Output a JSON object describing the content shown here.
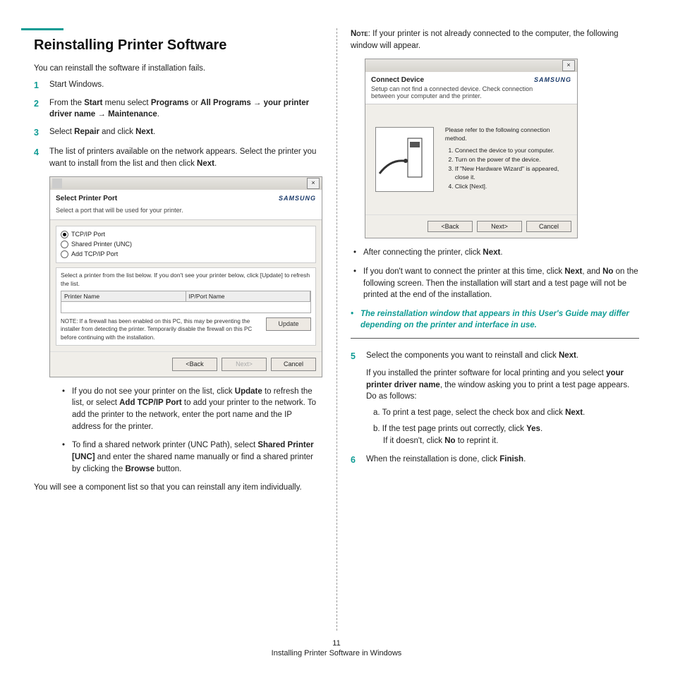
{
  "heading": "Reinstalling Printer Software",
  "intro": "You can reinstall the software if installation fails.",
  "step1": "Start Windows.",
  "step2_a": "From the ",
  "step2_start": "Start",
  "step2_b": " menu select ",
  "step2_programs": "Programs",
  "step2_or": " or ",
  "step2_allprograms": "All Programs",
  "step2_arrow1": " → ",
  "step2_driver": "your printer driver name",
  "step2_arrow2": " → ",
  "step2_maint": "Maintenance",
  "step3_a": "Select ",
  "step3_repair": "Repair",
  "step3_b": " and click ",
  "step3_next": "Next",
  "step4_a": "The list of printers available on the network appears. Select the printer you want to install from the list and then click ",
  "step4_next": "Next",
  "ss1": {
    "title": "Select Printer Port",
    "subtitle": "Select a port that will be used for your printer.",
    "brand": "SAMSUNG",
    "r1": "TCP/IP Port",
    "r2": "Shared Printer (UNC)",
    "r3": "Add TCP/IP Port",
    "listlbl": "Select a printer from the list below. If you don't see your printer below, click [Update] to refresh the list.",
    "th1": "Printer Name",
    "th2": "IP/Port Name",
    "note": "NOTE: If a firewall has been enabled on this PC, this may be preventing the installer from detecting the printer. Temporarily disable the firewall on this PC before continuing with the installation.",
    "update": "Update",
    "back": "<Back",
    "next": "Next>",
    "cancel": "Cancel"
  },
  "bullet1_a": "If you do not see your printer on the list, click ",
  "bullet1_update": "Update",
  "bullet1_b": " to refresh the list, or select ",
  "bullet1_add": "Add TCP/IP Port",
  "bullet1_c": " to add your printer to the network. To add the printer to the network, enter the port name and the IP address for the printer.",
  "bullet2_a": "To find a shared network printer (UNC Path), select ",
  "bullet2_shared": "Shared Printer [UNC]",
  "bullet2_b": " and enter the shared name manually or find a shared printer by clicking the ",
  "bullet2_browse": "Browse",
  "bullet2_c": " button.",
  "after4": "You will see a component list so that you can reinstall any item individually.",
  "note_label": "Note",
  "note_right": ": If your printer is not already connected to the computer, the following window will appear.",
  "ss2": {
    "title": "Connect Device",
    "subtitle": "Setup can not find a connected device. Check connection between your computer and the printer.",
    "brand": "SAMSUNG",
    "intro": "Please refer to the following connection method.",
    "i1": "Connect the device to your computer.",
    "i2": "Turn on the power of the device.",
    "i3": "If \"New Hardware Wizard\" is appeared, close it.",
    "i4": "Click [Next].",
    "back": "<Back",
    "next": "Next>",
    "cancel": "Cancel"
  },
  "rb1_a": "After connecting the printer, click ",
  "rb1_next": "Next",
  "rb2_a": "If you don't want to connect the printer at this time, click ",
  "rb2_next": "Next",
  "rb2_b": ", and ",
  "rb2_no": "No",
  "rb2_c": " on the following screen. Then the installation will start and a test page will not be printed at the end of the installation.",
  "teal": "The reinstallation window that appears in this User's Guide may differ depending on the printer and interface in use.",
  "step5_a": "Select the components you want to reinstall and click ",
  "step5_next": "Next",
  "step5_b": "If you installed the printer software for local printing and you select ",
  "step5_driver": "your printer driver name",
  "step5_c": ", the window asking you to print a test page appears. Do as follows:",
  "step5_la": "a. To print a test page, select the check box and click ",
  "step5_la_next": "Next",
  "step5_lb": "b. If the test page prints out correctly, click ",
  "step5_yes": "Yes",
  "step5_lb2": "If it doesn't, click ",
  "step5_no": "No",
  "step5_lb3": " to reprint it.",
  "step6_a": "When the reinstallation is done, click ",
  "step6_finish": "Finish",
  "page_num": "11",
  "footer_text": "Installing Printer Software in Windows"
}
